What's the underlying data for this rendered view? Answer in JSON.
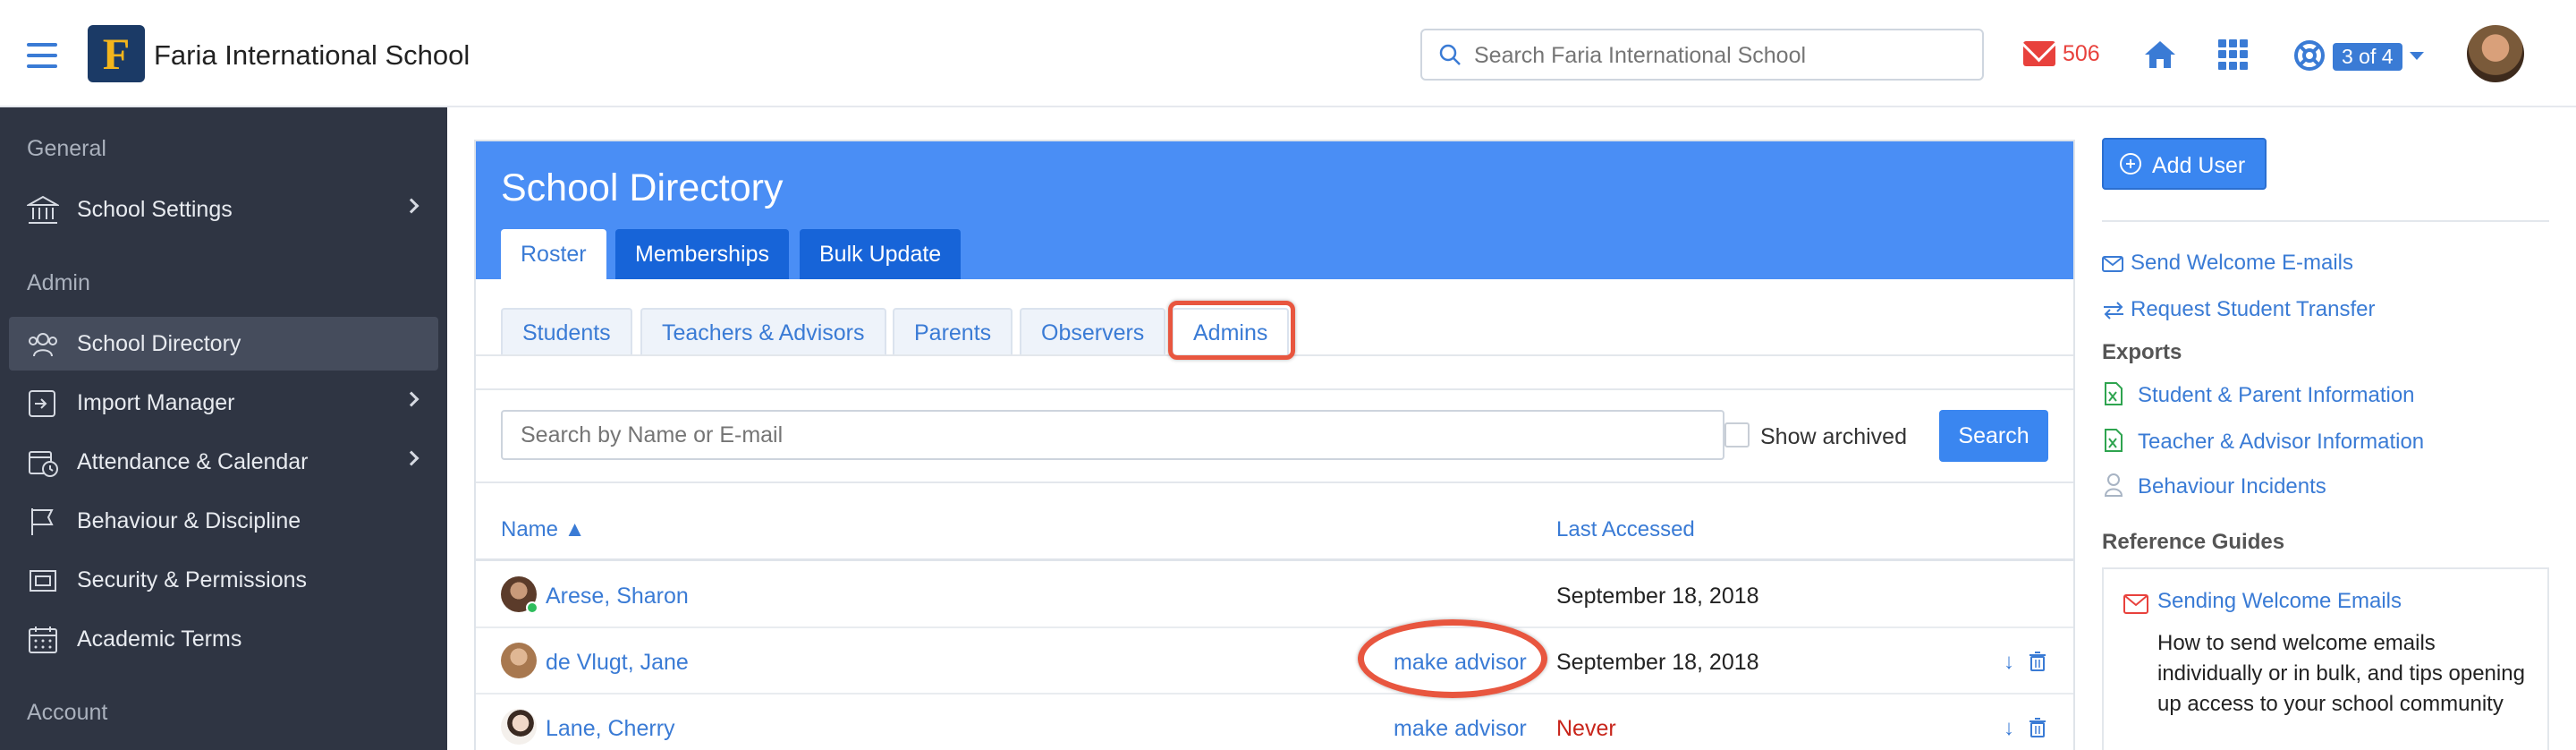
{
  "app": {
    "school_name": "Faria International School",
    "logo_letter": "F",
    "search_placeholder": "Search Faria International School",
    "mail_count": "506",
    "help_badge": "3 of 4"
  },
  "sidebar": {
    "sections": [
      {
        "label": "General"
      },
      {
        "label": "Admin"
      },
      {
        "label": "Account"
      }
    ],
    "items": [
      {
        "label": "School Settings",
        "icon": "bank-icon",
        "has_submenu": true
      },
      {
        "label": "School Directory",
        "icon": "users-icon",
        "active": true
      },
      {
        "label": "Import Manager",
        "icon": "import-icon",
        "has_submenu": true
      },
      {
        "label": "Attendance & Calendar",
        "icon": "calendar-clock-icon",
        "has_submenu": true
      },
      {
        "label": "Behaviour & Discipline",
        "icon": "flag-icon"
      },
      {
        "label": "Security & Permissions",
        "icon": "shield-icon"
      },
      {
        "label": "Academic Terms",
        "icon": "calendar-icon"
      }
    ]
  },
  "main": {
    "title": "School Directory",
    "tabs": [
      {
        "label": "Roster",
        "active": true
      },
      {
        "label": "Memberships"
      },
      {
        "label": "Bulk Update"
      }
    ],
    "subtabs": [
      {
        "label": "Students"
      },
      {
        "label": "Teachers & Advisors"
      },
      {
        "label": "Parents"
      },
      {
        "label": "Observers"
      },
      {
        "label": "Admins",
        "current": true
      }
    ],
    "search_placeholder": "Search by Name or E-mail",
    "show_archived_label": "Show archived",
    "search_button": "Search",
    "columns": {
      "name": "Name ▲",
      "last_accessed": "Last Accessed"
    },
    "rows": [
      {
        "name": "Arese, Sharon",
        "advisor_action": "",
        "last_accessed": "September 18, 2018"
      },
      {
        "name": "de Vlugt, Jane",
        "advisor_action": "make advisor",
        "last_accessed": "September 18, 2018"
      },
      {
        "name": "Lane, Cherry",
        "advisor_action": "make advisor",
        "last_accessed": "Never"
      }
    ]
  },
  "right_panel": {
    "add_user": "Add User",
    "links": [
      {
        "label": "Send Welcome E-mails",
        "icon": "envelope-outline-icon"
      },
      {
        "label": "Request Student Transfer",
        "icon": "transfer-icon"
      }
    ],
    "exports_heading": "Exports",
    "exports": [
      {
        "label": "Student & Parent Information",
        "icon": "excel-file-icon"
      },
      {
        "label": "Teacher & Advisor Information",
        "icon": "excel-file-icon"
      },
      {
        "label": "Behaviour Incidents",
        "icon": "person-outline-icon"
      }
    ],
    "guides_heading": "Reference Guides",
    "guide": {
      "title": "Sending Welcome Emails",
      "description": "How to send welcome emails individually or in bulk, and tips opening up access to your school community"
    }
  },
  "colors": {
    "primary": "#3a7bd5",
    "banner": "#4a8ef5",
    "sidebar_bg": "#2f3543",
    "alert_red": "#e8413c",
    "highlight_ring": "#e8563f"
  }
}
